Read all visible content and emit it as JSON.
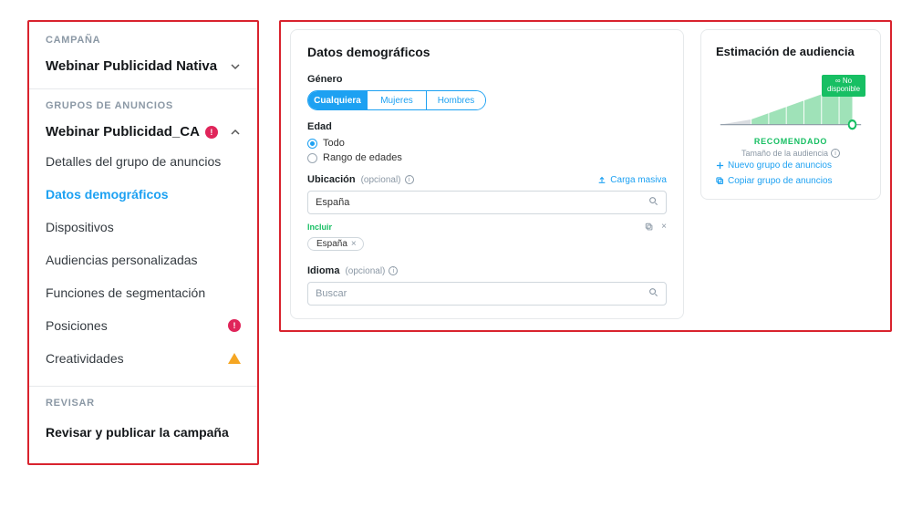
{
  "sidebar": {
    "campaign_section": "CAMPAÑA",
    "campaign_name": "Webinar Publicidad Nativa",
    "groups_section": "GRUPOS DE ANUNCIOS",
    "group_name": "Webinar Publicidad_CA",
    "items": [
      {
        "label": "Detalles del grupo de anuncios",
        "selected": false,
        "err": false,
        "warn": false
      },
      {
        "label": "Datos demográficos",
        "selected": true,
        "err": false,
        "warn": false
      },
      {
        "label": "Dispositivos",
        "selected": false,
        "err": false,
        "warn": false
      },
      {
        "label": "Audiencias personalizadas",
        "selected": false,
        "err": false,
        "warn": false
      },
      {
        "label": "Funciones de segmentación",
        "selected": false,
        "err": false,
        "warn": false
      },
      {
        "label": "Posiciones",
        "selected": false,
        "err": true,
        "warn": false
      },
      {
        "label": "Creatividades",
        "selected": false,
        "err": false,
        "warn": true
      }
    ],
    "review_section": "REVISAR",
    "review_label": "Revisar y publicar la campaña"
  },
  "demographics": {
    "title": "Datos demográficos",
    "gender_label": "Género",
    "gender_options": [
      "Cualquiera",
      "Mujeres",
      "Hombres"
    ],
    "gender_selected": 0,
    "age_label": "Edad",
    "age_options": [
      "Todo",
      "Rango de edades"
    ],
    "age_selected": 0,
    "location_label": "Ubicación",
    "optional": "(opcional)",
    "bulk_upload": "Carga masiva",
    "location_value": "España",
    "include_label": "Incluir",
    "language_label": "Idioma",
    "search_placeholder": "Buscar"
  },
  "audience": {
    "title": "Estimación de audiencia",
    "tag_line1": "∞ No",
    "tag_line2": "disponible",
    "recommended": "RECOMENDADO",
    "size_label": "Tamaño de la audiencia",
    "link_new": "Nuevo grupo de anuncios",
    "link_copy": "Copiar grupo de anuncios"
  }
}
